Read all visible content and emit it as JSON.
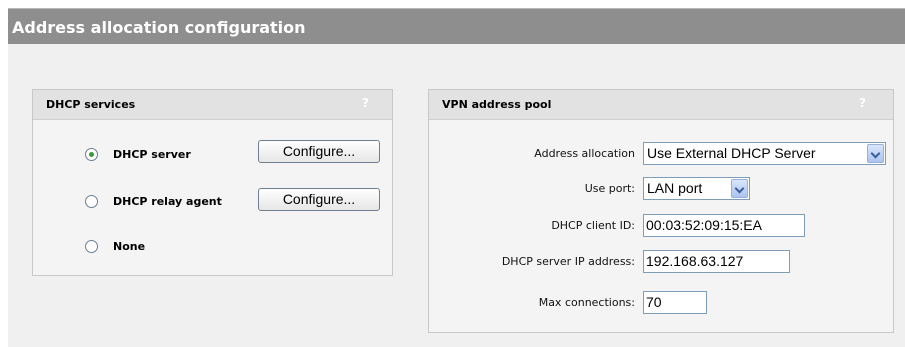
{
  "page": {
    "title": "Address allocation configuration"
  },
  "dhcp_services": {
    "header": "DHCP services",
    "help": "?",
    "options": [
      {
        "label": "DHCP server",
        "checked": true,
        "configure_label": "Configure..."
      },
      {
        "label": "DHCP relay agent",
        "checked": false,
        "configure_label": "Configure..."
      },
      {
        "label": "None",
        "checked": false
      }
    ]
  },
  "vpn_pool": {
    "header": "VPN address pool",
    "help": "?",
    "address_allocation": {
      "label": "Address allocation",
      "value": "Use External DHCP Server"
    },
    "use_port": {
      "label": "Use port:",
      "value": "LAN port"
    },
    "dhcp_client_id": {
      "label": "DHCP client ID:",
      "value": "00:03:52:09:15:EA"
    },
    "dhcp_server_ip": {
      "label": "DHCP server IP address:",
      "value": "192.168.63.127"
    },
    "max_connections": {
      "label": "Max connections:",
      "value": "70"
    }
  },
  "colors": {
    "title_bar": "#8e8e8e",
    "panel_header": "#e2e2e2",
    "radio_selected": "#3a9a3a"
  }
}
